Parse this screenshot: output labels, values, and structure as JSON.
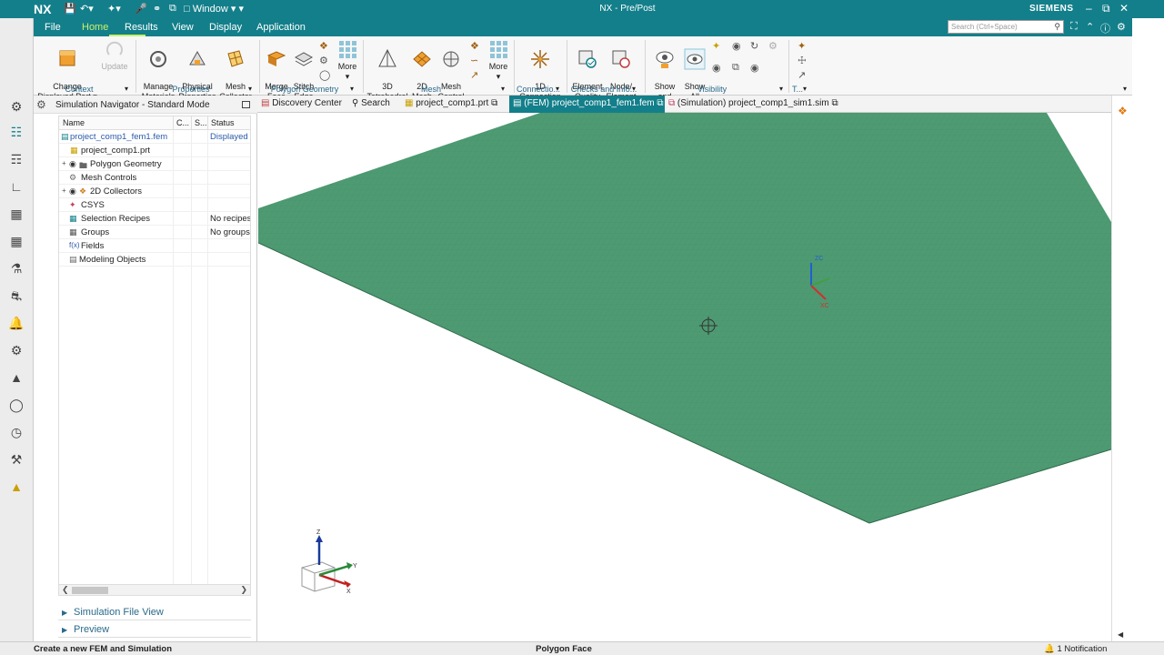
{
  "app": {
    "logo": "NX",
    "window_title": "NX - Pre/Post",
    "brand": "SIEMENS",
    "quick_access_window": "Window"
  },
  "menu": {
    "items": [
      {
        "label": "File"
      },
      {
        "label": "Home"
      },
      {
        "label": "Results"
      },
      {
        "label": "View"
      },
      {
        "label": "Display"
      },
      {
        "label": "Application"
      }
    ],
    "active": "Home",
    "search_placeholder": "Search (Ctrl+Space)"
  },
  "ribbon": {
    "buttons": {
      "change_displayed_part": "Change\nDisplayed Part",
      "update": "Update",
      "manage_materials": "Manage\nMaterials",
      "physical_properties": "Physical\nProperties",
      "mesh_collector": "Mesh\nCollector",
      "merge_face": "Merge\nFace",
      "stitch_edge": "Stitch\nEdge",
      "more_geometry": "More",
      "tetrahedral_3d": "3D\nTetrahedral",
      "mesh_2d": "2D\nMesh",
      "mesh_control": "Mesh\nControl",
      "more_mesh": "More",
      "connection_1d": "1D\nConnection",
      "element_quality": "Element\nQuality",
      "node_element": "Node/\nElement",
      "show_and_hide": "Show\nand Hide",
      "show_all": "Show\nAll"
    },
    "groups": {
      "context": "Context",
      "properties": "Properties",
      "polygon_geometry": "Polygon Geometry",
      "mesh": "Mesh",
      "connections": "Connectio...",
      "checks": "Checks and Info...",
      "visibility": "Visibility",
      "t": "T..."
    }
  },
  "navigator": {
    "title": "Simulation Navigator - Standard Mode",
    "columns": {
      "name": "Name",
      "c": "C...",
      "s": "S...",
      "status": "Status"
    },
    "rows": [
      {
        "label": "project_comp1_fem1.fem",
        "status": "Displayed"
      },
      {
        "label": "project_comp1.prt",
        "status": ""
      },
      {
        "label": "Polygon Geometry",
        "status": ""
      },
      {
        "label": "Mesh Controls",
        "status": ""
      },
      {
        "label": "2D Collectors",
        "status": ""
      },
      {
        "label": "CSYS",
        "status": ""
      },
      {
        "label": "Selection Recipes",
        "status": "No recipes"
      },
      {
        "label": "Groups",
        "status": "No groups"
      },
      {
        "label": "Fields",
        "status": ""
      },
      {
        "label": "Modeling Objects",
        "status": ""
      }
    ],
    "sections": {
      "file_view": "Simulation File View",
      "preview": "Preview"
    }
  },
  "tabs": [
    {
      "label": "Discovery Center"
    },
    {
      "label": "Search"
    },
    {
      "label": "project_comp1.prt"
    },
    {
      "label": "(FEM) project_comp1_fem1.fem"
    },
    {
      "label": "(Simulation) project_comp1_sim1.sim"
    }
  ],
  "viewport": {
    "mesh_color": "#4e9a72",
    "mesh_line_color": "#3f8760",
    "triad": {
      "x": "X",
      "y": "Y",
      "z": "Z"
    },
    "wcs": {
      "zc": "ZC",
      "xc": "XC"
    }
  },
  "status": {
    "left": "Create a new FEM and Simulation",
    "center": "Polygon Face",
    "notification": "1 Notification"
  },
  "colors": {
    "accent": "#137f8a",
    "active_menu": "#c8f16a"
  }
}
